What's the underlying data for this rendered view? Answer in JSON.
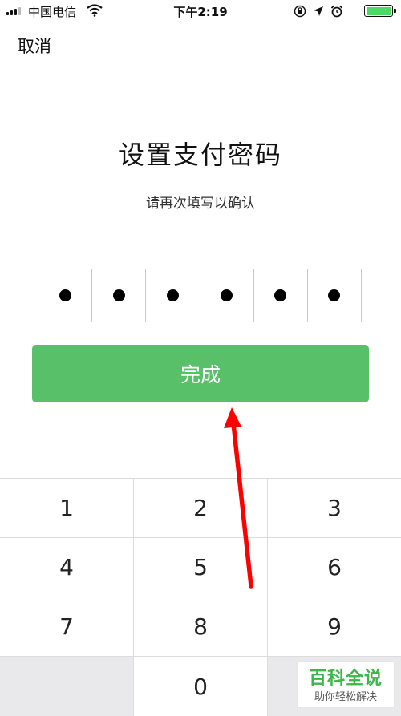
{
  "status_bar": {
    "carrier": "中国电信",
    "time": "下午2:19",
    "battery_color": "#4cd964",
    "icons": [
      "signal-icon",
      "wifi-icon",
      "orientation-lock-icon",
      "location-icon",
      "alarm-icon",
      "battery-icon"
    ]
  },
  "header": {
    "cancel_label": "取消"
  },
  "main": {
    "title": "设置支付密码",
    "subtitle": "请再次填写以确认",
    "pin": [
      "●",
      "●",
      "●",
      "●",
      "●",
      "●"
    ],
    "done_label": "完成",
    "done_color": "#57c069"
  },
  "keypad": {
    "rows": [
      [
        "1",
        "2",
        "3"
      ],
      [
        "4",
        "5",
        "6"
      ],
      [
        "7",
        "8",
        "9"
      ],
      [
        "",
        "0",
        ""
      ]
    ]
  },
  "annotation": {
    "arrow_color": "#ff0000"
  },
  "watermark": {
    "title": "百科全说",
    "subtitle": "助你轻松解决"
  }
}
